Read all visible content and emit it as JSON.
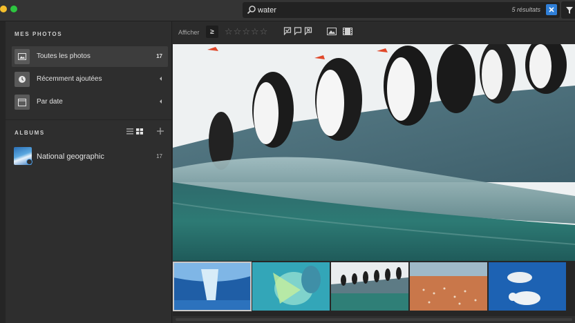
{
  "search": {
    "value": "water",
    "result_count": "5 résultats",
    "icon": "magnifier-icon",
    "clear_icon": "close-icon"
  },
  "sidebar": {
    "my_photos_title": "MES PHOTOS",
    "items": [
      {
        "label": "Toutes les photos",
        "count": "17",
        "icon": "photo-icon",
        "active": true
      },
      {
        "label": "Récemment ajoutées",
        "icon": "clock-icon"
      },
      {
        "label": "Par date",
        "icon": "calendar-icon"
      }
    ],
    "albums_title": "ALBUMS",
    "albums": [
      {
        "label": "National geographic",
        "count": "17",
        "icon": "album-thumbnail"
      }
    ]
  },
  "toolbar": {
    "show_label": "Afficher",
    "rating_operator": "≥",
    "stars": [
      "☆",
      "☆",
      "☆",
      "☆",
      "☆"
    ]
  },
  "colors": {
    "accent": "#2f7fd8",
    "sidebar_bg": "#2e2e2e",
    "active_item_bg": "#3d3d3d"
  }
}
